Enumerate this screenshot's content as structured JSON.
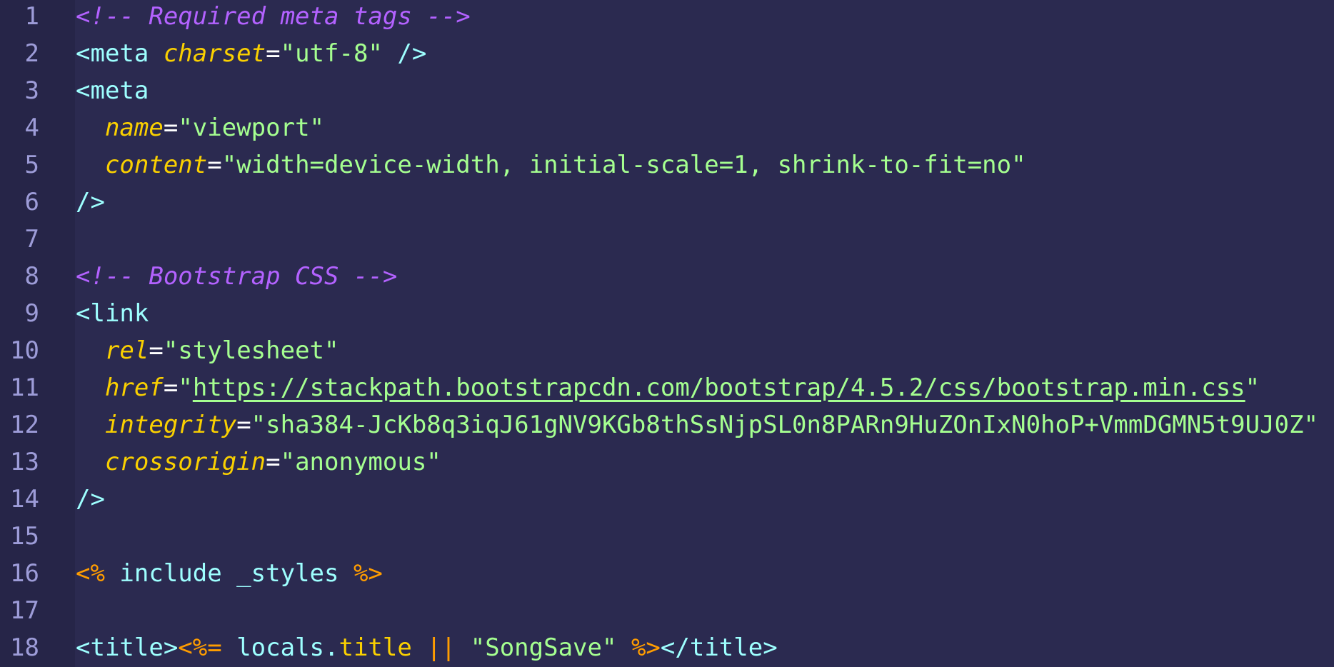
{
  "editor": {
    "lines": [
      {
        "n": "1",
        "t": [
          {
            "c": "comment",
            "v": "<!-- Required meta tags -->"
          }
        ]
      },
      {
        "n": "2",
        "t": [
          {
            "c": "tag",
            "v": "<meta "
          },
          {
            "c": "attr",
            "v": "charset"
          },
          {
            "c": "eq",
            "v": "="
          },
          {
            "c": "str",
            "v": "\"utf-8\""
          },
          {
            "c": "tag",
            "v": " />"
          }
        ]
      },
      {
        "n": "3",
        "t": [
          {
            "c": "tag",
            "v": "<meta"
          }
        ]
      },
      {
        "n": "4",
        "t": [
          {
            "c": "tag",
            "v": "  "
          },
          {
            "c": "attr",
            "v": "name"
          },
          {
            "c": "eq",
            "v": "="
          },
          {
            "c": "str",
            "v": "\"viewport\""
          }
        ]
      },
      {
        "n": "5",
        "t": [
          {
            "c": "tag",
            "v": "  "
          },
          {
            "c": "attr",
            "v": "content"
          },
          {
            "c": "eq",
            "v": "="
          },
          {
            "c": "str",
            "v": "\"width=device-width, initial-scale=1, shrink-to-fit=no\""
          }
        ]
      },
      {
        "n": "6",
        "t": [
          {
            "c": "tag",
            "v": "/>"
          }
        ]
      },
      {
        "n": "7",
        "t": []
      },
      {
        "n": "8",
        "t": [
          {
            "c": "comment",
            "v": "<!-- Bootstrap CSS -->"
          }
        ]
      },
      {
        "n": "9",
        "t": [
          {
            "c": "tag",
            "v": "<link"
          }
        ]
      },
      {
        "n": "10",
        "t": [
          {
            "c": "tag",
            "v": "  "
          },
          {
            "c": "attr",
            "v": "rel"
          },
          {
            "c": "eq",
            "v": "="
          },
          {
            "c": "str",
            "v": "\"stylesheet\""
          }
        ]
      },
      {
        "n": "11",
        "t": [
          {
            "c": "tag",
            "v": "  "
          },
          {
            "c": "attr",
            "v": "href"
          },
          {
            "c": "eq",
            "v": "="
          },
          {
            "c": "quote",
            "v": "\""
          },
          {
            "c": "url",
            "v": "https://stackpath.bootstrapcdn.com/bootstrap/4.5.2/css/bootstrap.min.css"
          },
          {
            "c": "quote",
            "v": "\""
          }
        ]
      },
      {
        "n": "12",
        "t": [
          {
            "c": "tag",
            "v": "  "
          },
          {
            "c": "attr",
            "v": "integrity"
          },
          {
            "c": "eq",
            "v": "="
          },
          {
            "c": "str",
            "v": "\"sha384-JcKb8q3iqJ61gNV9KGb8thSsNjpSL0n8PARn9HuZOnIxN0hoP+VmmDGMN5t9UJ0Z\""
          }
        ]
      },
      {
        "n": "13",
        "t": [
          {
            "c": "tag",
            "v": "  "
          },
          {
            "c": "attr",
            "v": "crossorigin"
          },
          {
            "c": "eq",
            "v": "="
          },
          {
            "c": "str",
            "v": "\"anonymous\""
          }
        ]
      },
      {
        "n": "14",
        "t": [
          {
            "c": "tag",
            "v": "/>"
          }
        ]
      },
      {
        "n": "15",
        "t": []
      },
      {
        "n": "16",
        "t": [
          {
            "c": "ejs",
            "v": "<%"
          },
          {
            "c": "plain",
            "v": " include _styles "
          },
          {
            "c": "ejs",
            "v": "%>"
          }
        ]
      },
      {
        "n": "17",
        "t": []
      },
      {
        "n": "18",
        "t": [
          {
            "c": "tag",
            "v": "<title>"
          },
          {
            "c": "ejs",
            "v": "<%="
          },
          {
            "c": "plain",
            "v": " locals."
          },
          {
            "c": "prop",
            "v": "title"
          },
          {
            "c": "plain",
            "v": " "
          },
          {
            "c": "op",
            "v": "||"
          },
          {
            "c": "plain",
            "v": " "
          },
          {
            "c": "str",
            "v": "\"SongSave\""
          },
          {
            "c": "plain",
            "v": " "
          },
          {
            "c": "ejs",
            "v": "%>"
          },
          {
            "c": "tag",
            "v": "</title>"
          }
        ]
      }
    ]
  }
}
